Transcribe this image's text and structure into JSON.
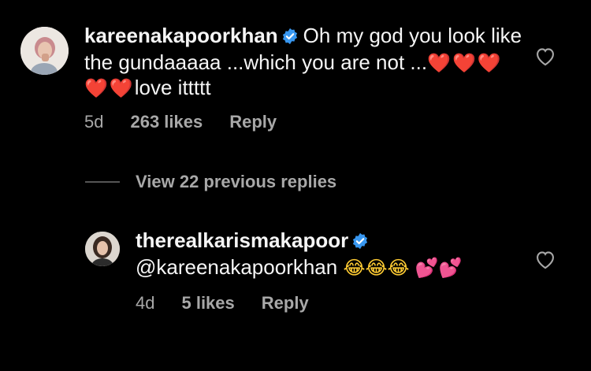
{
  "comment": {
    "username": "kareenakapoorkhan",
    "text_before": "Oh my god you look like the gundaaaaa ...which you are not ...",
    "emojis": "❤️❤️❤️❤️❤️",
    "text_after": "love ittttt",
    "age": "5d",
    "likes": "263 likes",
    "reply_label": "Reply",
    "verified": true
  },
  "view_replies": {
    "label": "View 22 previous replies"
  },
  "reply": {
    "username": "therealkarismakapoor",
    "mention": "@kareenakapoorkhan",
    "emojis_laugh": "😂😂😂",
    "emojis_hearts": "💕💕",
    "age": "4d",
    "likes": "5 likes",
    "reply_label": "Reply",
    "verified": true
  },
  "icons": {
    "like": "heart-outline-icon",
    "verified": "verified-badge-icon"
  },
  "colors": {
    "background": "#000000",
    "primary_text": "#f5f5f5",
    "secondary_text": "#a8a8a8",
    "verified_blue": "#3897f0"
  }
}
